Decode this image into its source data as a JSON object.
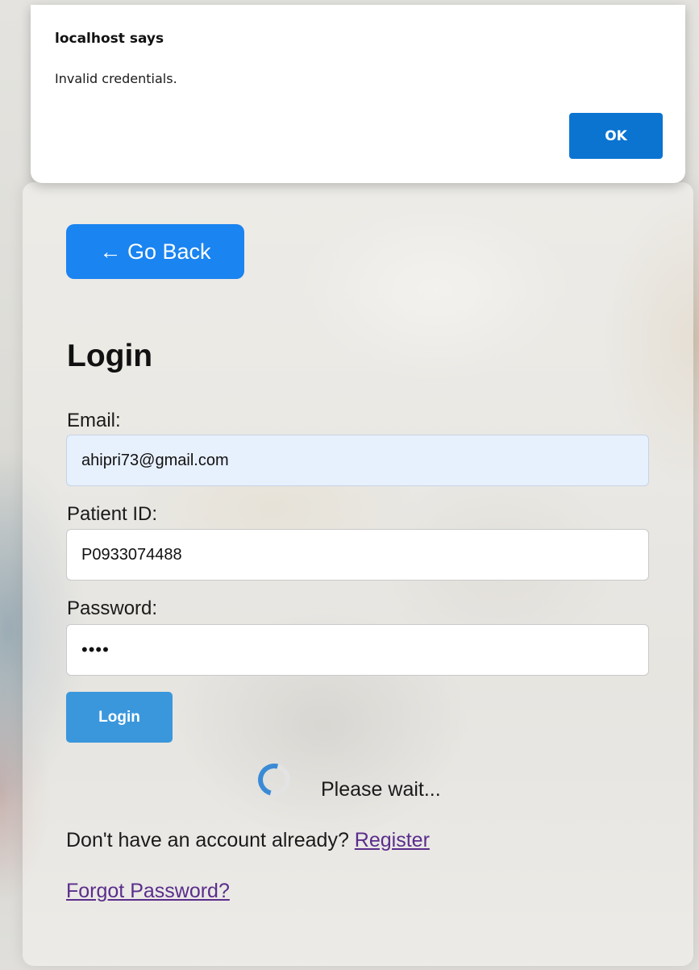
{
  "dialog": {
    "title": "localhost says",
    "message": "Invalid credentials.",
    "ok_label": "OK"
  },
  "nav": {
    "back_label": "← Go Back"
  },
  "form": {
    "title": "Login",
    "email_label": "Email:",
    "email_value": "ahipri73@gmail.com",
    "patient_id_label": "Patient ID:",
    "patient_id_value": "P0933074488",
    "password_label": "Password:",
    "password_value": "abcd",
    "submit_label": "Login"
  },
  "status": {
    "loading_text": "Please wait..."
  },
  "footer": {
    "register_prompt": "Don't have an account already?",
    "register_link": "Register",
    "forgot_link": "Forgot Password?"
  },
  "colors": {
    "back_button": "#1a84f0",
    "login_button": "#3a97dc",
    "ok_button": "#0b74d1",
    "link": "#5a2d8c",
    "autofill_field": "#e7f0fd"
  }
}
